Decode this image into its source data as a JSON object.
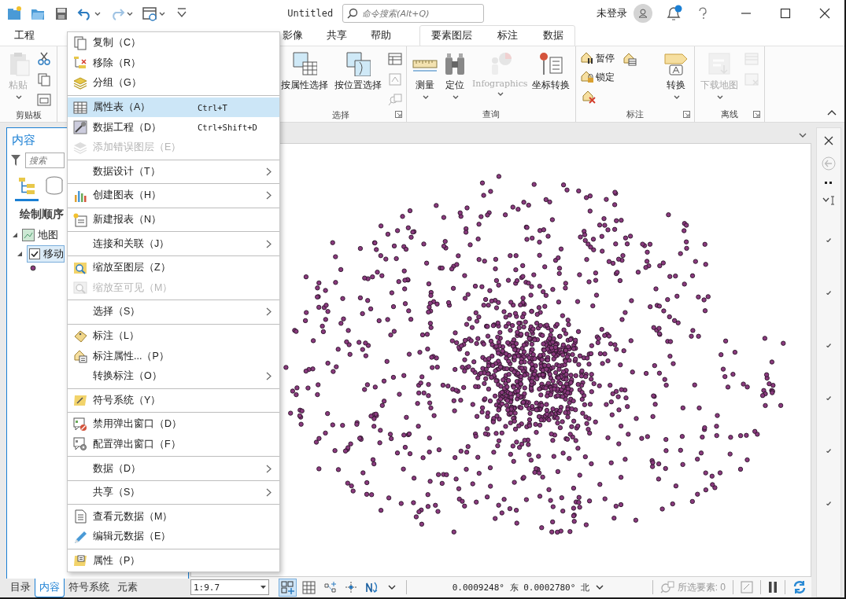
{
  "title_bar": {
    "quick_access": [
      {
        "disabled": false,
        "dropdown": false
      },
      {
        "disabled": false,
        "dropdown": false
      },
      {
        "disabled": false,
        "dropdown": false
      },
      {
        "disabled": false,
        "dropdown": true
      },
      {
        "disabled": true,
        "dropdown": true
      },
      {
        "disabled": false,
        "dropdown": true
      },
      {
        "disabled": false,
        "dropdown": false
      }
    ],
    "title": "Untitled",
    "command_search": {
      "placeholder": "命令搜索(Alt+Q)"
    },
    "account": "未登录",
    "notifications": {
      "unread": true
    }
  },
  "ribbon": {
    "tabs": [
      {
        "label": "工程",
        "selected": false
      },
      {
        "label": "影像",
        "selected": false
      },
      {
        "label": "共享",
        "selected": false
      },
      {
        "label": "帮助",
        "selected": false
      }
    ],
    "contextual_tabs": [
      {
        "label": "要素图层",
        "selected": false
      },
      {
        "label": "标注",
        "selected": false
      },
      {
        "label": "数据",
        "selected": false
      }
    ],
    "groups": [
      {
        "label": "剪贴板",
        "launcher": false,
        "buttons": [
          {
            "kind": "large",
            "label": "粘贴",
            "dropdown": true,
            "disabled": true
          },
          {
            "kind": "icon",
            "disabled": false
          },
          {
            "kind": "icon",
            "disabled": false
          },
          {
            "kind": "icon",
            "disabled": false
          }
        ]
      },
      {
        "label": "选择",
        "launcher": true,
        "buttons": [
          {
            "kind": "large",
            "label": "按属性选择",
            "dropdown": false,
            "disabled": false
          },
          {
            "kind": "large",
            "label": "按位置选择",
            "dropdown": false,
            "disabled": false
          },
          {
            "kind": "icon",
            "disabled": false
          },
          {
            "kind": "icon",
            "disabled": true
          },
          {
            "kind": "icon",
            "disabled": true
          }
        ]
      },
      {
        "label": "查询",
        "launcher": false,
        "buttons": [
          {
            "kind": "large",
            "label": "测量",
            "dropdown": true,
            "disabled": false
          },
          {
            "kind": "large",
            "label": "定位",
            "dropdown": true,
            "disabled": false
          },
          {
            "kind": "large",
            "label": "Infographics",
            "dropdown": true,
            "disabled": true
          },
          {
            "kind": "large",
            "label": "坐标转换",
            "dropdown": false,
            "disabled": false
          }
        ]
      },
      {
        "label": "标注",
        "launcher": true,
        "buttons": [
          {
            "kind": "small",
            "label": "暂停",
            "disabled": false
          },
          {
            "kind": "small",
            "label": "锁定",
            "disabled": false
          },
          {
            "kind": "icon",
            "disabled": false
          },
          {
            "kind": "icon",
            "disabled": false
          },
          {
            "kind": "large",
            "label": "转换",
            "dropdown": true,
            "disabled": false
          }
        ]
      },
      {
        "label": "离线",
        "launcher": true,
        "buttons": [
          {
            "kind": "large",
            "label": "下载地图",
            "dropdown": true,
            "disabled": true
          },
          {
            "kind": "icon",
            "disabled": true
          },
          {
            "kind": "icon",
            "disabled": true
          }
        ]
      }
    ]
  },
  "contents_pane": {
    "title": "内容",
    "search": {
      "placeholder": "搜索"
    },
    "view_tabs": [
      {
        "selected": true
      },
      {
        "selected": false
      }
    ],
    "heading": "绘制顺序",
    "tree": [
      {
        "label": "地图",
        "expanded": true,
        "children": [
          {
            "label": "移动",
            "checked": true,
            "selected": true,
            "expanded": true
          }
        ]
      }
    ],
    "pane_tabs": [
      {
        "label": "目录",
        "selected": false
      },
      {
        "label": "内容",
        "selected": true
      },
      {
        "label": "符号系统",
        "selected": false
      },
      {
        "label": "元素",
        "selected": false
      }
    ]
  },
  "context_menu": {
    "items": [
      {
        "kind": "item",
        "label": "复制（C）",
        "disabled": false,
        "selected": false,
        "submenu": false
      },
      {
        "kind": "item",
        "label": "移除（R）",
        "disabled": false,
        "selected": false,
        "submenu": false
      },
      {
        "kind": "item",
        "label": "分组（G）",
        "disabled": false,
        "selected": false,
        "submenu": false
      },
      {
        "kind": "separator"
      },
      {
        "kind": "item",
        "label": "属性表（A）",
        "shortcut": "Ctrl+T",
        "disabled": false,
        "selected": true,
        "submenu": false
      },
      {
        "kind": "item",
        "label": "数据工程（D）",
        "shortcut": "Ctrl+Shift+D",
        "disabled": false,
        "selected": false,
        "submenu": false
      },
      {
        "kind": "item",
        "label": "添加错误图层（E）",
        "disabled": true,
        "selected": false,
        "submenu": false
      },
      {
        "kind": "separator"
      },
      {
        "kind": "item",
        "label": "数据设计（T）",
        "disabled": false,
        "selected": false,
        "submenu": true
      },
      {
        "kind": "separator"
      },
      {
        "kind": "item",
        "label": "创建图表（H）",
        "disabled": false,
        "selected": false,
        "submenu": true
      },
      {
        "kind": "separator"
      },
      {
        "kind": "item",
        "label": "新建报表（N）",
        "disabled": false,
        "selected": false,
        "submenu": false
      },
      {
        "kind": "separator"
      },
      {
        "kind": "item",
        "label": "连接和关联（J）",
        "disabled": false,
        "selected": false,
        "submenu": true
      },
      {
        "kind": "separator"
      },
      {
        "kind": "item",
        "label": "缩放至图层（Z）",
        "disabled": false,
        "selected": false,
        "submenu": false
      },
      {
        "kind": "item",
        "label": "缩放至可见（M）",
        "disabled": true,
        "selected": false,
        "submenu": false
      },
      {
        "kind": "separator"
      },
      {
        "kind": "item",
        "label": "选择（S）",
        "disabled": false,
        "selected": false,
        "submenu": true
      },
      {
        "kind": "separator"
      },
      {
        "kind": "item",
        "label": "标注（L）",
        "disabled": false,
        "selected": false,
        "submenu": false
      },
      {
        "kind": "item",
        "label": "标注属性...（P）",
        "disabled": false,
        "selected": false,
        "submenu": false
      },
      {
        "kind": "item",
        "label": "转换标注（O）",
        "disabled": false,
        "selected": false,
        "submenu": true
      },
      {
        "kind": "separator"
      },
      {
        "kind": "item",
        "label": "符号系统（Y）",
        "disabled": false,
        "selected": false,
        "submenu": false
      },
      {
        "kind": "separator"
      },
      {
        "kind": "item",
        "label": "禁用弹出窗口（D）",
        "disabled": false,
        "selected": false,
        "submenu": false
      },
      {
        "kind": "item",
        "label": "配置弹出窗口（F）",
        "disabled": false,
        "selected": false,
        "submenu": false
      },
      {
        "kind": "separator"
      },
      {
        "kind": "item",
        "label": "数据（D）",
        "disabled": false,
        "selected": false,
        "submenu": true
      },
      {
        "kind": "separator"
      },
      {
        "kind": "item",
        "label": "共享（S）",
        "disabled": false,
        "selected": false,
        "submenu": true
      },
      {
        "kind": "separator"
      },
      {
        "kind": "item",
        "label": "查看元数据（M）",
        "disabled": false,
        "selected": false,
        "submenu": false
      },
      {
        "kind": "item",
        "label": "编辑元数据（E）",
        "disabled": false,
        "selected": false,
        "submenu": false
      },
      {
        "kind": "separator"
      },
      {
        "kind": "item",
        "label": "属性（P）",
        "disabled": false,
        "selected": false,
        "submenu": false
      }
    ]
  },
  "status_bar": {
    "scale": "1:9.7",
    "tools": [
      {
        "selected": true
      },
      {
        "selected": false
      },
      {
        "selected": false
      },
      {
        "selected": false
      },
      {
        "selected": false
      }
    ],
    "coordinates": "0.0009248° 东 0.0002780° 北",
    "selected_features": "所选要素: 0"
  }
}
